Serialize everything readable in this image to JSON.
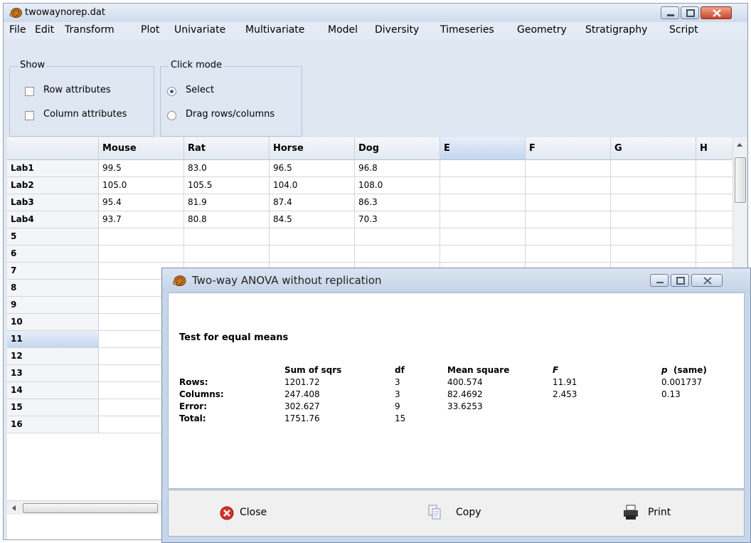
{
  "window": {
    "title": "twowaynorep.dat"
  },
  "menu": [
    "File",
    "Edit",
    "Transform",
    "Plot",
    "Univariate",
    "Multivariate",
    "Model",
    "Diversity",
    "Timeseries",
    "Geometry",
    "Stratigraphy",
    "Script"
  ],
  "show_group": {
    "legend": "Show",
    "row_attributes": "Row attributes",
    "column_attributes": "Column attributes",
    "row_checked": false,
    "column_checked": false
  },
  "click_mode_group": {
    "legend": "Click mode",
    "select": "Select",
    "drag": "Drag rows/columns",
    "selected": "select"
  },
  "grid": {
    "columns": [
      "Mouse",
      "Rat",
      "Horse",
      "Dog",
      "E",
      "F",
      "G",
      "H"
    ],
    "rows": [
      {
        "label": "Lab1",
        "values": [
          "99.5",
          "83.0",
          "96.5",
          "96.8"
        ]
      },
      {
        "label": "Lab2",
        "values": [
          "105.0",
          "105.5",
          "104.0",
          "108.0"
        ]
      },
      {
        "label": "Lab3",
        "values": [
          "95.4",
          "81.9",
          "87.4",
          "86.3"
        ]
      },
      {
        "label": "Lab4",
        "values": [
          "93.7",
          "80.8",
          "84.5",
          "70.3"
        ]
      },
      {
        "label": "5",
        "values": []
      },
      {
        "label": "6",
        "values": []
      },
      {
        "label": "7",
        "values": []
      },
      {
        "label": "8",
        "values": []
      },
      {
        "label": "9",
        "values": []
      },
      {
        "label": "10",
        "values": []
      },
      {
        "label": "11",
        "values": []
      },
      {
        "label": "12",
        "values": []
      },
      {
        "label": "13",
        "values": []
      },
      {
        "label": "14",
        "values": []
      },
      {
        "label": "15",
        "values": []
      },
      {
        "label": "16",
        "values": []
      }
    ],
    "selected_column": "E",
    "selected_row": "11"
  },
  "dialog": {
    "title": "Two-way ANOVA without replication",
    "heading": "Test for equal means",
    "headers": {
      "sum_of_sqrs": "Sum of sqrs",
      "df": "df",
      "mean_square": "Mean square",
      "f": "F",
      "p": "p",
      "p_suffix": "(same)"
    },
    "rows": [
      {
        "label": "Rows:",
        "ss": "1201.72",
        "df": "3",
        "ms": "400.574",
        "f": "11.91",
        "p": "0.001737"
      },
      {
        "label": "Columns:",
        "ss": "247.408",
        "df": "3",
        "ms": "82.4692",
        "f": "2.453",
        "p": "0.13"
      },
      {
        "label": "Error:",
        "ss": "302.627",
        "df": "9",
        "ms": "33.6253",
        "f": "",
        "p": ""
      },
      {
        "label": "Total:",
        "ss": "1751.76",
        "df": "15",
        "ms": "",
        "f": "",
        "p": ""
      }
    ],
    "buttons": {
      "close": "Close",
      "copy": "Copy",
      "print": "Print"
    }
  }
}
